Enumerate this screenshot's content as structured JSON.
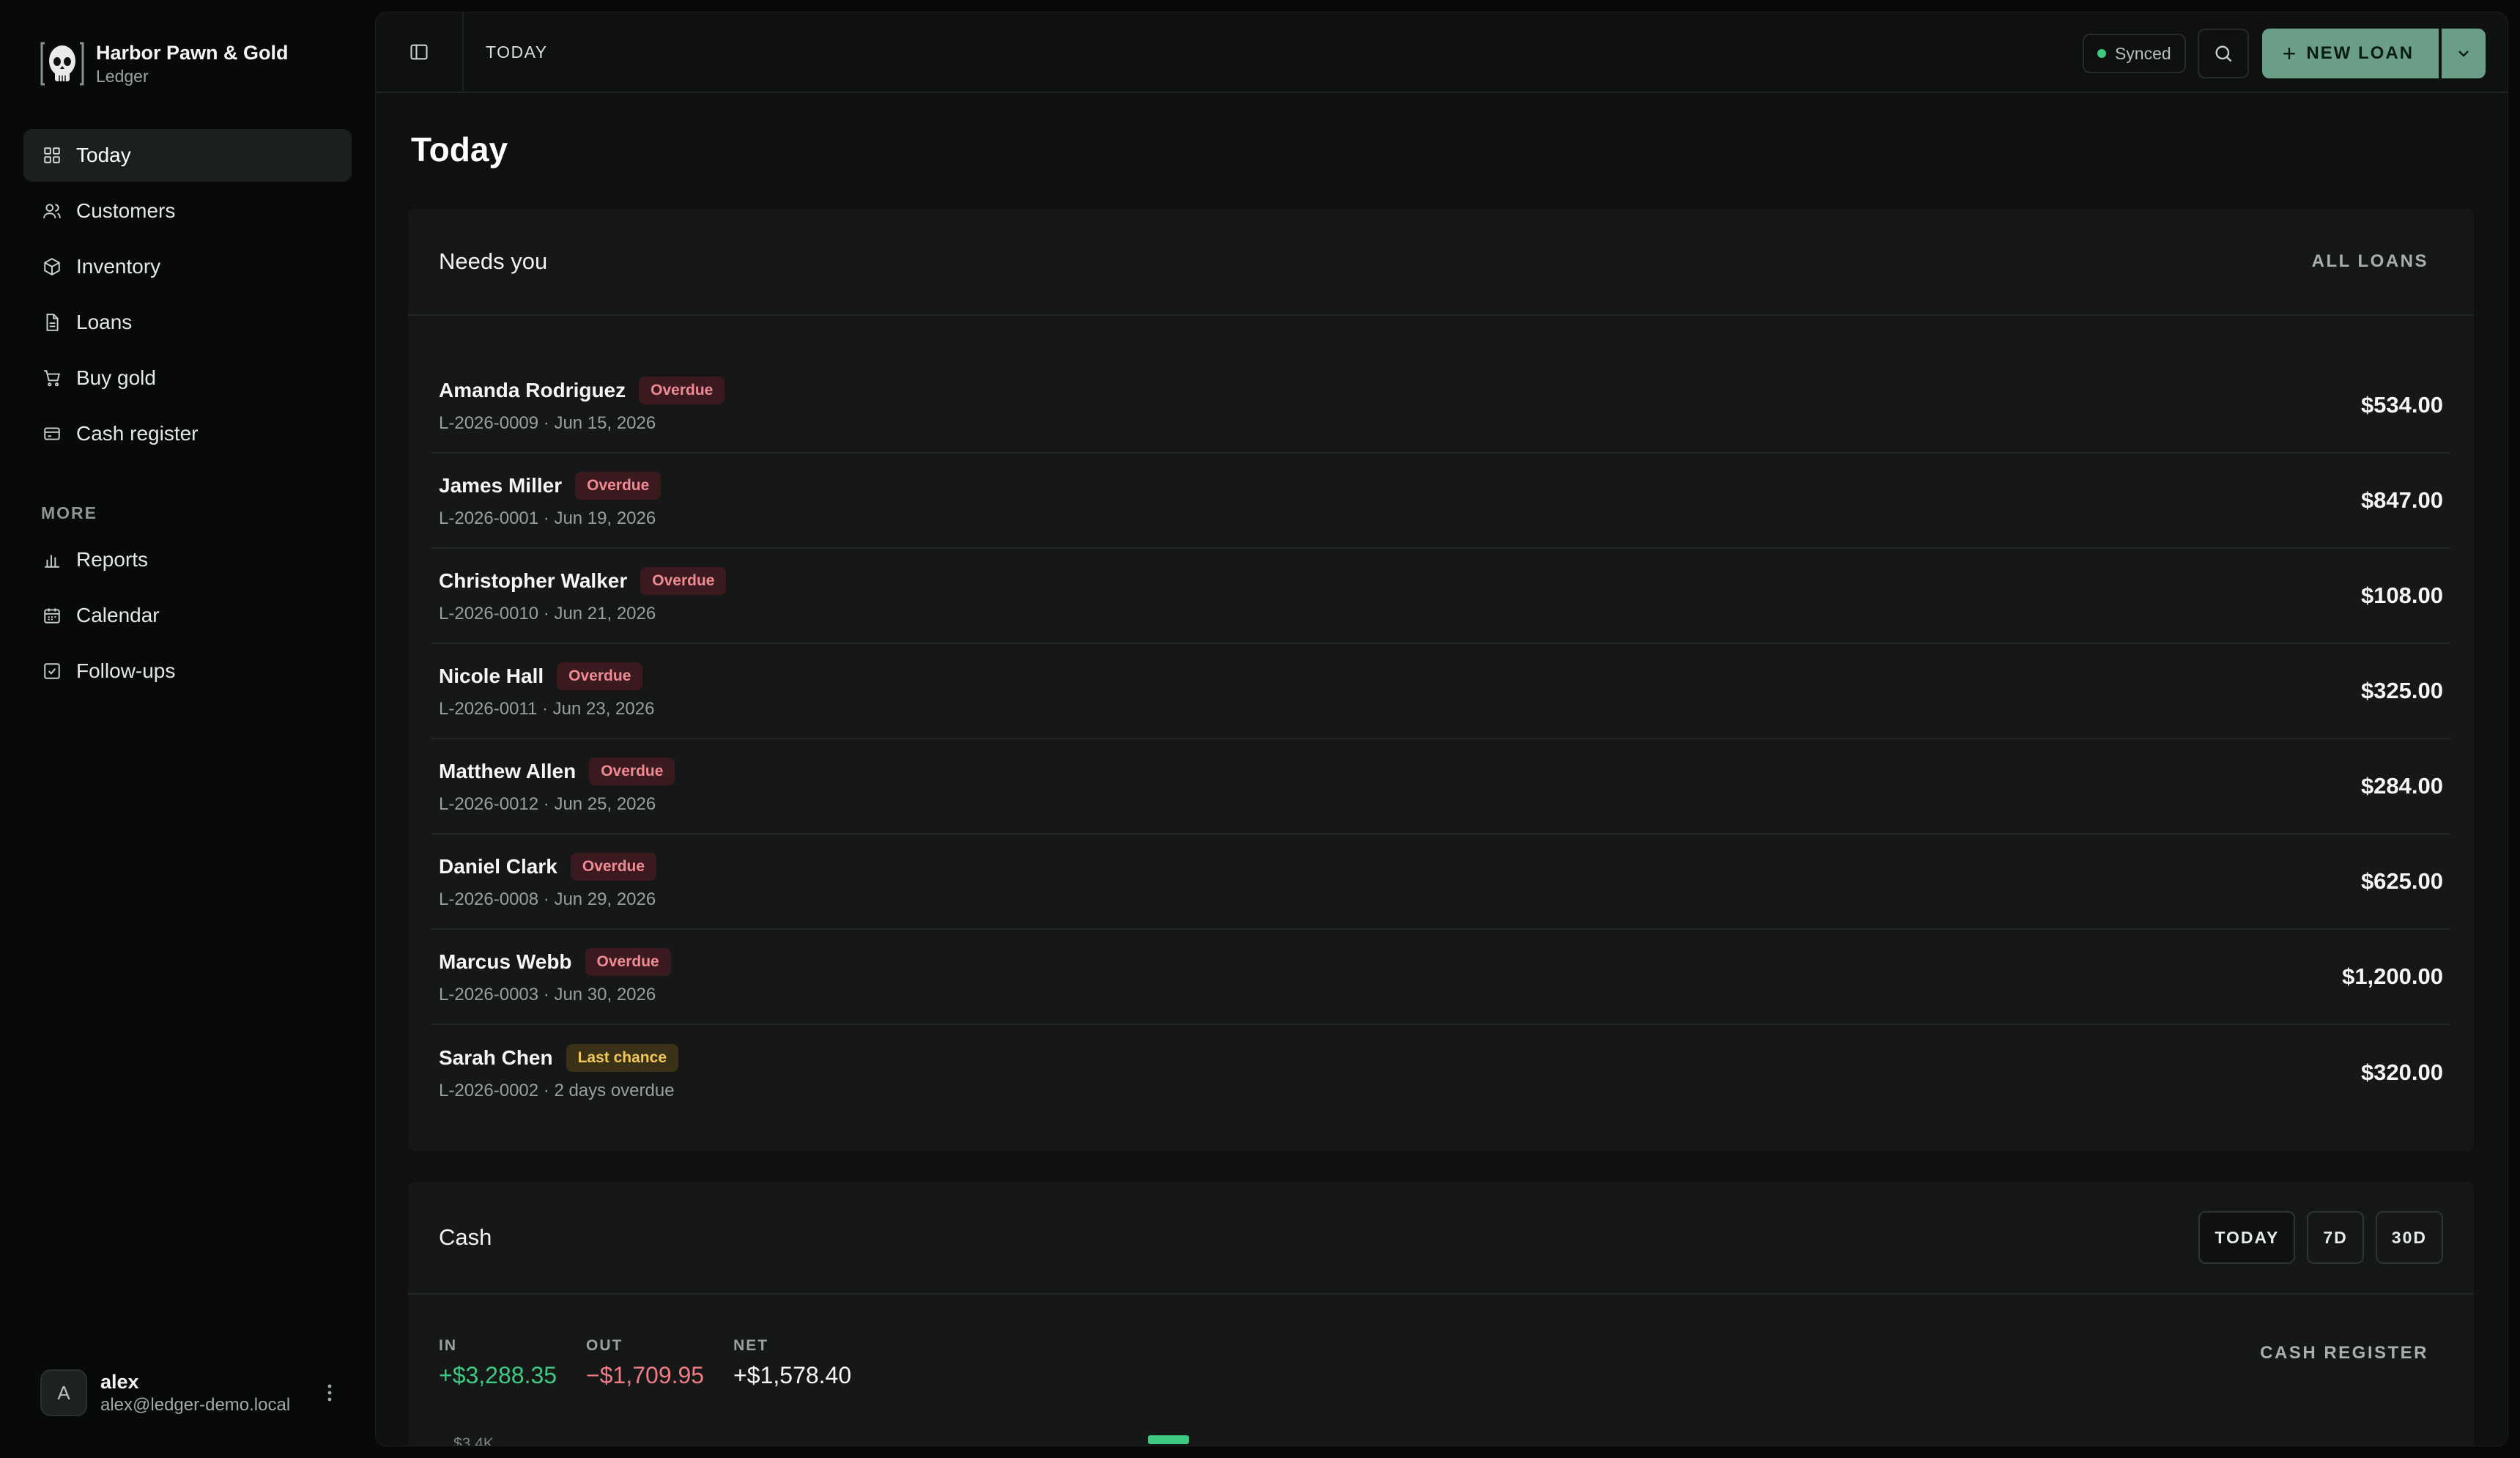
{
  "brand": {
    "name": "Harbor Pawn & Gold",
    "subtitle": "Ledger"
  },
  "nav": {
    "primary": [
      {
        "label": "Today",
        "icon": "grid-icon",
        "active": true
      },
      {
        "label": "Customers",
        "icon": "users-icon"
      },
      {
        "label": "Inventory",
        "icon": "box-icon"
      },
      {
        "label": "Loans",
        "icon": "document-icon"
      },
      {
        "label": "Buy gold",
        "icon": "cart-icon"
      },
      {
        "label": "Cash register",
        "icon": "register-icon"
      }
    ],
    "more_label": "MORE",
    "more": [
      {
        "label": "Reports",
        "icon": "bar-chart-icon"
      },
      {
        "label": "Calendar",
        "icon": "calendar-icon"
      },
      {
        "label": "Follow-ups",
        "icon": "checkbox-icon"
      }
    ]
  },
  "user": {
    "initial": "A",
    "name": "alex",
    "email": "alex@ledger-demo.local"
  },
  "topbar": {
    "breadcrumb": "TODAY",
    "sync_status": "Synced",
    "new_loan_label": "NEW LOAN"
  },
  "page": {
    "title": "Today"
  },
  "needs_you": {
    "title": "Needs you",
    "link_label": "ALL LOANS",
    "loans": [
      {
        "name": "Amanda Rodriguez",
        "badge": "Overdue",
        "badge_type": "overdue",
        "meta": "L-2026-0009 · Jun 15, 2026",
        "amount": "$534.00"
      },
      {
        "name": "James Miller",
        "badge": "Overdue",
        "badge_type": "overdue",
        "meta": "L-2026-0001 · Jun 19, 2026",
        "amount": "$847.00"
      },
      {
        "name": "Christopher Walker",
        "badge": "Overdue",
        "badge_type": "overdue",
        "meta": "L-2026-0010 · Jun 21, 2026",
        "amount": "$108.00"
      },
      {
        "name": "Nicole Hall",
        "badge": "Overdue",
        "badge_type": "overdue",
        "meta": "L-2026-0011 · Jun 23, 2026",
        "amount": "$325.00"
      },
      {
        "name": "Matthew Allen",
        "badge": "Overdue",
        "badge_type": "overdue",
        "meta": "L-2026-0012 · Jun 25, 2026",
        "amount": "$284.00"
      },
      {
        "name": "Daniel Clark",
        "badge": "Overdue",
        "badge_type": "overdue",
        "meta": "L-2026-0008 · Jun 29, 2026",
        "amount": "$625.00"
      },
      {
        "name": "Marcus Webb",
        "badge": "Overdue",
        "badge_type": "overdue",
        "meta": "L-2026-0003 · Jun 30, 2026",
        "amount": "$1,200.00"
      },
      {
        "name": "Sarah Chen",
        "badge": "Last chance",
        "badge_type": "last",
        "meta": "L-2026-0002 · 2 days overdue",
        "amount": "$320.00"
      }
    ]
  },
  "cash": {
    "title": "Cash",
    "ranges": [
      {
        "label": "TODAY",
        "active": true
      },
      {
        "label": "7D"
      },
      {
        "label": "30D"
      }
    ],
    "in_label": "IN",
    "in_value": "+$3,288.35",
    "out_label": "OUT",
    "out_value": "−$1,709.95",
    "net_label": "NET",
    "net_value": "+$1,578.40",
    "link_label": "CASH REGISTER",
    "chart_tick": "$3.4K"
  },
  "colors": {
    "accent": "#6b9e86",
    "positive": "#3fca84",
    "negative": "#f07b86",
    "overdue_badge": "#f08a93",
    "last_chance_badge": "#f0c75a"
  }
}
